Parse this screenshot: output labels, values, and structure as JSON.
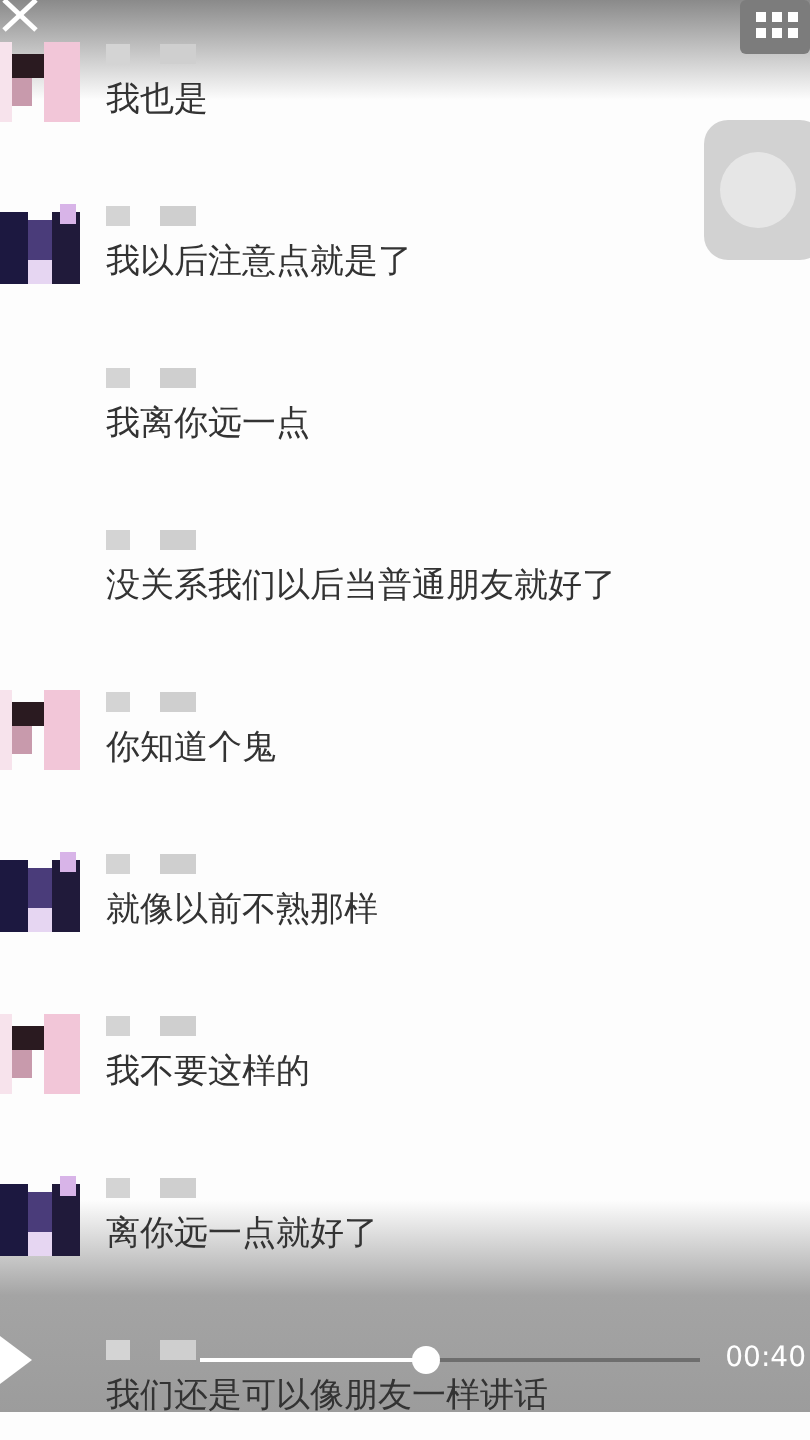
{
  "messages": [
    {
      "text": "我也是",
      "kind": "light"
    },
    {
      "text": "我以后注意点就是了",
      "kind": "dark"
    },
    {
      "text": "我离你远一点",
      "kind": "plain"
    },
    {
      "text": "没关系我们以后当普通朋友就好了",
      "kind": "plain"
    },
    {
      "text": "你知道个鬼",
      "kind": "light"
    },
    {
      "text": "就像以前不熟那样",
      "kind": "dark"
    },
    {
      "text": "我不要这样的",
      "kind": "light"
    },
    {
      "text": "离你远一点就好了",
      "kind": "dark"
    },
    {
      "text": "我们还是可以像朋友一样讲话",
      "kind": "plain"
    }
  ],
  "player": {
    "total_time": "00:40",
    "level": 0.45
  }
}
